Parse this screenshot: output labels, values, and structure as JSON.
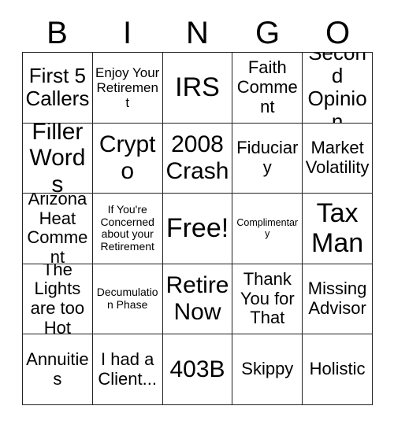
{
  "card": {
    "title": "BINGO",
    "header_letters": [
      "B",
      "I",
      "N",
      "G",
      "O"
    ],
    "free_space_label": "Free!",
    "rows": [
      [
        {
          "text": "First 5 Callers",
          "size": "lg"
        },
        {
          "text": "Enjoy Your Retirement",
          "size": "sm"
        },
        {
          "text": "IRS",
          "size": "xxl"
        },
        {
          "text": "Faith Comment",
          "size": "md"
        },
        {
          "text": "Second Opinion",
          "size": "lg"
        }
      ],
      [
        {
          "text": "Filler Words",
          "size": "xl"
        },
        {
          "text": "Crypto",
          "size": "xl"
        },
        {
          "text": "2008 Crash",
          "size": "xl"
        },
        {
          "text": "Fiduciary",
          "size": "md"
        },
        {
          "text": "Market Volatility",
          "size": "md"
        }
      ],
      [
        {
          "text": "Arizona Heat Comment",
          "size": "md"
        },
        {
          "text": "If You're Concerned about your Retirement",
          "size": "xs"
        },
        {
          "text": "Free!",
          "size": "xxl"
        },
        {
          "text": "Complimentary",
          "size": "xxs"
        },
        {
          "text": "Tax Man",
          "size": "xxl"
        }
      ],
      [
        {
          "text": "The Lights are too Hot",
          "size": "md"
        },
        {
          "text": "Decumulation Phase",
          "size": "xs"
        },
        {
          "text": "Retire Now",
          "size": "xl"
        },
        {
          "text": "Thank You for That",
          "size": "md"
        },
        {
          "text": "Missing Advisor",
          "size": "md"
        }
      ],
      [
        {
          "text": "Annuities",
          "size": "md"
        },
        {
          "text": "I had a Client...",
          "size": "md"
        },
        {
          "text": "403B",
          "size": "xl"
        },
        {
          "text": "Skippy",
          "size": "md"
        },
        {
          "text": "Holistic",
          "size": "md"
        }
      ]
    ]
  },
  "colors": {
    "background": "#ffffff",
    "text": "#000000",
    "grid_line": "#222222"
  }
}
